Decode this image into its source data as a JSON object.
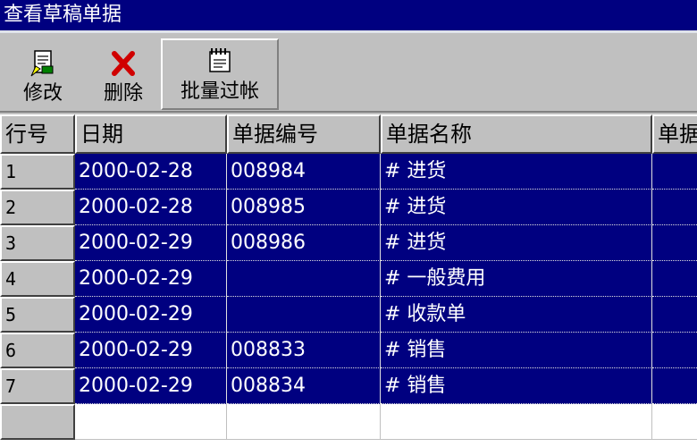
{
  "window": {
    "title": "查看草稿单据"
  },
  "toolbar": {
    "buttons": [
      {
        "label": "修改",
        "icon": "edit-document-icon"
      },
      {
        "label": "删除",
        "icon": "red-x-delete-icon"
      },
      {
        "label": "批量过帐",
        "icon": "batch-post-notepad-icon"
      }
    ]
  },
  "table": {
    "row_header_label": "行号",
    "columns": [
      "日期",
      "单据编号",
      "单据名称",
      "单据"
    ],
    "rows": [
      {
        "num": "1",
        "date": "2000-02-28",
        "code": "008984",
        "name": "# 进货"
      },
      {
        "num": "2",
        "date": "2000-02-28",
        "code": "008985",
        "name": "# 进货"
      },
      {
        "num": "3",
        "date": "2000-02-29",
        "code": "008986",
        "name": "# 进货"
      },
      {
        "num": "4",
        "date": "2000-02-29",
        "code": "",
        "name": "# 一般费用"
      },
      {
        "num": "5",
        "date": "2000-02-29",
        "code": "",
        "name": "# 收款单"
      },
      {
        "num": "6",
        "date": "2000-02-29",
        "code": "008833",
        "name": "# 销售"
      },
      {
        "num": "7",
        "date": "2000-02-29",
        "code": "008834",
        "name": "# 销售"
      }
    ]
  },
  "colors": {
    "title_bg": "#000080",
    "selection_bg": "#000080",
    "face": "#c0c0c0"
  }
}
